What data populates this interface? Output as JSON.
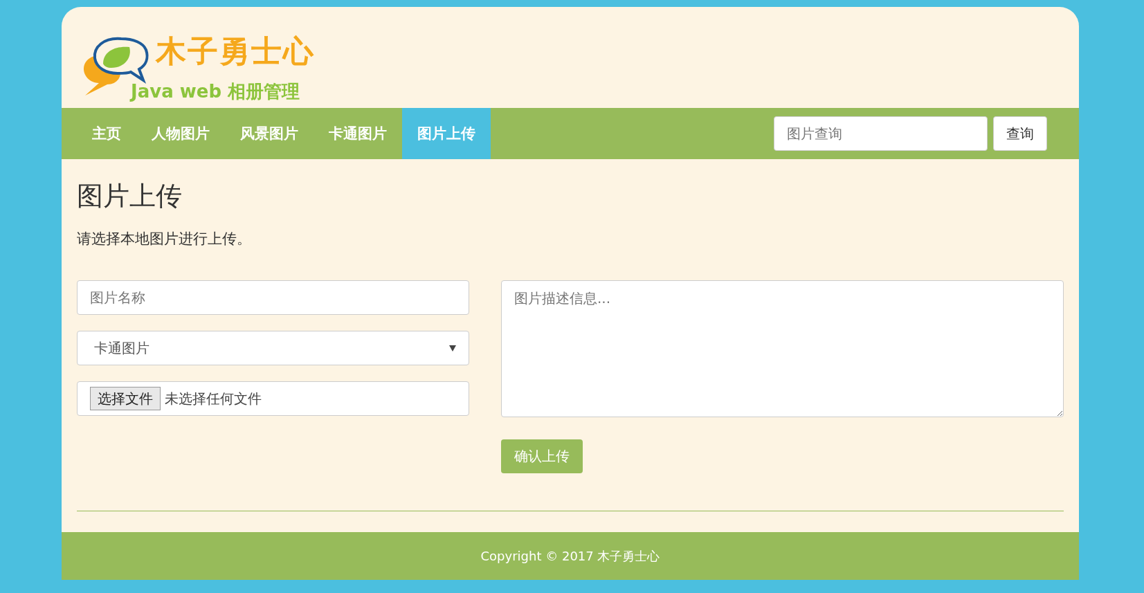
{
  "logo": {
    "title": "木子勇士心",
    "subtitle": "Java web 相册管理"
  },
  "nav": {
    "items": [
      {
        "label": "主页",
        "selected": false
      },
      {
        "label": "人物图片",
        "selected": false
      },
      {
        "label": "风景图片",
        "selected": false
      },
      {
        "label": "卡通图片",
        "selected": false
      },
      {
        "label": "图片上传",
        "selected": true
      }
    ],
    "search": {
      "placeholder": "图片查询"
    },
    "search_button": "查询"
  },
  "page": {
    "heading": "图片上传",
    "description": "请选择本地图片进行上传。"
  },
  "form": {
    "name_field": {
      "placeholder": "图片名称"
    },
    "category": {
      "value": "卡通图片"
    },
    "file": {
      "button": "选择文件",
      "status": "未选择任何文件"
    },
    "description_field": {
      "placeholder": "图片描述信息..."
    },
    "submit": "确认上传"
  },
  "footer": {
    "text": "Copyright © 2017 木子勇士心"
  }
}
